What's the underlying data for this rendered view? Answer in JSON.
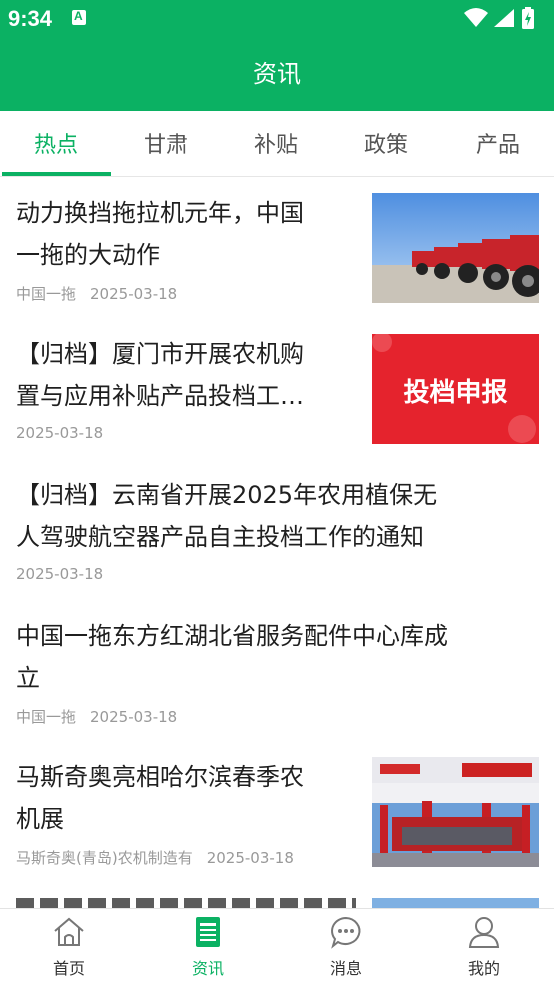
{
  "status_bar": {
    "time": "9:34",
    "notification_icon": "A"
  },
  "header": {
    "title": "资讯"
  },
  "tabs": [
    {
      "label": "热点",
      "active": true
    },
    {
      "label": "甘肃",
      "active": false
    },
    {
      "label": "补贴",
      "active": false
    },
    {
      "label": "政策",
      "active": false
    },
    {
      "label": "产品",
      "active": false
    }
  ],
  "articles": [
    {
      "title_line1": "动力换挡拖拉机元年，中国",
      "title_line2": "一拖的大动作",
      "source": "中国一拖",
      "date": "2025-03-18",
      "thumb": "tractors-photo"
    },
    {
      "title_line1": "【归档】厦门市开展农机购",
      "title_line2": "置与应用补贴产品投档工…",
      "source": "",
      "date": "2025-03-18",
      "thumb": "red-banner",
      "thumb_text": "投档申报"
    },
    {
      "title_line1": "【归档】云南省开展2025年农用植保无",
      "title_line2": "人驾驶航空器产品自主投档工作的通知",
      "source": "",
      "date": "2025-03-18"
    },
    {
      "title_line1": "中国一拖东方红湖北省服务配件中心库成",
      "title_line2": "立",
      "source": "中国一拖",
      "date": "2025-03-18"
    },
    {
      "title_line1": "马斯奇奥亮相哈尔滨春季农",
      "title_line2": "机展",
      "source": "马斯奇奥(青岛)农机制造有",
      "date": "2025-03-18",
      "thumb": "expo-photo"
    }
  ],
  "bottom_nav": [
    {
      "label": "首页",
      "icon": "home-icon",
      "active": false
    },
    {
      "label": "资讯",
      "icon": "news-icon",
      "active": true
    },
    {
      "label": "消息",
      "icon": "message-icon",
      "active": false
    },
    {
      "label": "我的",
      "icon": "user-icon",
      "active": false
    }
  ],
  "colors": {
    "primary": "#0bb163",
    "text": "#1f1f1f",
    "meta": "#999999"
  }
}
